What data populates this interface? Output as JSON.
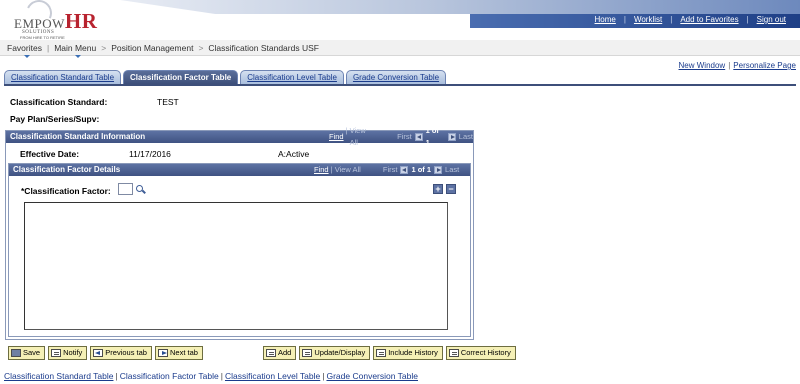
{
  "brand": {
    "logo_text_prefix": "EMPOW",
    "logo_text_suffix": "HR",
    "logo_tagline": "SOLUTIONS",
    "logo_subtagline": "FROM HIRE TO RETIRE"
  },
  "header_links": [
    "Home",
    "Worklist",
    "Add to Favorites",
    "Sign out"
  ],
  "breadcrumb": {
    "favorites": "Favorites",
    "main_menu": "Main Menu",
    "position_mgmt": "Position Management",
    "current": "Classification Standards USF",
    "separator": ">"
  },
  "window_links": {
    "new_window": "New Window",
    "personalize": "Personalize Page",
    "separator": "|"
  },
  "tabs": [
    {
      "label": "Classification Standard Table",
      "active": false
    },
    {
      "label": "Classification Factor Table",
      "active": true
    },
    {
      "label": "Classification Level Table",
      "active": false
    },
    {
      "label": "Grade Conversion Table",
      "active": false
    }
  ],
  "fields": {
    "classification_standard_label": "Classification Standard:",
    "classification_standard_value": "TEST",
    "pay_plan_label": "Pay Plan/Series/Supv:"
  },
  "standard_info": {
    "title": "Classification Standard Information",
    "find": "Find",
    "view_all": "View All",
    "first": "First",
    "page": "1 of 1",
    "last": "Last",
    "effective_date_label": "Effective Date:",
    "effective_date_value": "11/17/2016",
    "status_value": "A:Active"
  },
  "factor_details": {
    "title": "Classification Factor Details",
    "find": "Find",
    "view_all": "View All",
    "first": "First",
    "page": "1 of 1",
    "last": "Last",
    "factor_label": "*Classification Factor:",
    "factor_value": "",
    "add_symbol": "+",
    "remove_symbol": "−"
  },
  "toolbar": {
    "save": "Save",
    "notify": "Notify",
    "previous_tab": "Previous tab",
    "next_tab": "Next tab",
    "add": "Add",
    "update_display": "Update/Display",
    "include_history": "Include History",
    "correct_history": "Correct History"
  },
  "bottom_links": {
    "standard_table": "Classification Standard Table",
    "factor_table": "Classification Factor Table",
    "level_table": "Classification Level Table",
    "grade_table": "Grade Conversion Table",
    "separator": "|"
  },
  "colors": {
    "header_blue": "#1e3f86",
    "grid_header": "#3f5282",
    "button_yellow": "#f5f0b6",
    "link_blue": "#1a3b8c",
    "logo_red": "#b8232f"
  }
}
